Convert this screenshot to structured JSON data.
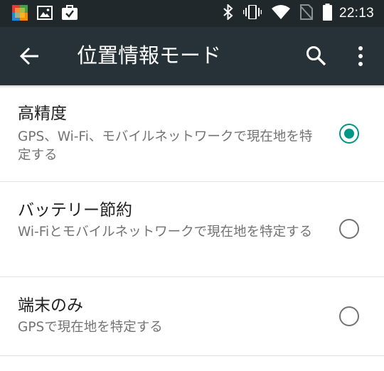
{
  "status_bar": {
    "time": "22:13",
    "left_icons": [
      "app-icon",
      "image-icon",
      "briefcase-check-icon"
    ],
    "right_icons": [
      "bluetooth-icon",
      "vibrate-icon",
      "wifi-icon",
      "no-sim-icon",
      "battery-icon"
    ]
  },
  "app_bar": {
    "title": "位置情報モード",
    "back_icon": "arrow-back-icon",
    "search_icon": "search-icon",
    "menu_icon": "more-vert-icon"
  },
  "options": [
    {
      "title": "高精度",
      "summary": "GPS、Wi-Fi、モバイルネットワークで現在地を特定する",
      "selected": true
    },
    {
      "title": "バッテリー節約",
      "summary": "Wi-Fiとモバイルネットワークで現在地を特定する",
      "selected": false
    },
    {
      "title": "端末のみ",
      "summary": "GPSで現在地を特定する",
      "selected": false
    }
  ],
  "colors": {
    "status_bar": "#21282b",
    "app_bar": "#263238",
    "accent": "#009688",
    "title_text": "#212121",
    "summary_text": "#737373"
  }
}
